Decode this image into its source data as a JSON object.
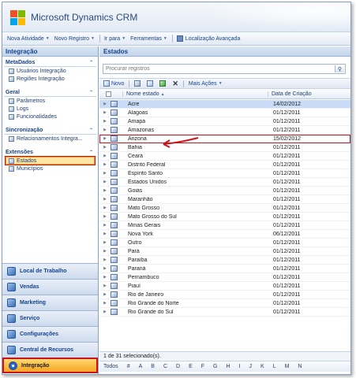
{
  "app": {
    "title": "Microsoft Dynamics CRM"
  },
  "menubar": {
    "items": [
      {
        "label": "Nova Atividade"
      },
      {
        "label": "Novo Registro"
      },
      {
        "label": "Ir para"
      },
      {
        "label": "Ferramentas"
      },
      {
        "label": "Localização Avançada"
      }
    ]
  },
  "leftnav": {
    "title": "Integração",
    "groups": [
      {
        "label": "MetaDados",
        "items": [
          "Usuários Integração",
          "Regiões Integração"
        ]
      },
      {
        "label": "Geral",
        "items": [
          "Parâmetros",
          "Logs",
          "Funcionalidades"
        ]
      },
      {
        "label": "Sincronização",
        "items": [
          "Relacionamentos Integra..."
        ]
      },
      {
        "label": "Extensões",
        "items": [
          "Estados",
          "Municípios"
        ]
      }
    ],
    "selected_item": "Estados",
    "wunderbar": [
      "Local de Trabalho",
      "Vendas",
      "Marketing",
      "Serviço",
      "Configurações",
      "Central de Recursos",
      "Integração"
    ],
    "active_area": "Integração"
  },
  "main": {
    "title": "Estados",
    "search": {
      "placeholder": "Procurar registros",
      "value": ""
    },
    "toolbar": {
      "new_label": "Novo",
      "more_actions_label": "Mais Ações"
    },
    "columns": {
      "name": "Nome estado",
      "date": "Data de Criação"
    },
    "rows": [
      {
        "name": "Acre",
        "date": "14/02/2012"
      },
      {
        "name": "Alagoas",
        "date": "01/12/2011"
      },
      {
        "name": "Amapá",
        "date": "01/12/2011"
      },
      {
        "name": "Amazonas",
        "date": "01/12/2011"
      },
      {
        "name": "Arizona",
        "date": "15/02/2012"
      },
      {
        "name": "Bahia",
        "date": "01/12/2011"
      },
      {
        "name": "Ceará",
        "date": "01/12/2011"
      },
      {
        "name": "Distrito Federal",
        "date": "01/12/2011"
      },
      {
        "name": "Espírito Santo",
        "date": "01/12/2011"
      },
      {
        "name": "Estados Unidos",
        "date": "01/12/2011"
      },
      {
        "name": "Goiás",
        "date": "01/12/2011"
      },
      {
        "name": "Maranhão",
        "date": "01/12/2011"
      },
      {
        "name": "Mato Grosso",
        "date": "01/12/2011"
      },
      {
        "name": "Mato Grosso do Sul",
        "date": "01/12/2011"
      },
      {
        "name": "Minas Gerais",
        "date": "01/12/2011"
      },
      {
        "name": "Nova York",
        "date": "06/12/2011"
      },
      {
        "name": "Outro",
        "date": "01/12/2011"
      },
      {
        "name": "Pará",
        "date": "01/12/2011"
      },
      {
        "name": "Paraíba",
        "date": "01/12/2011"
      },
      {
        "name": "Paraná",
        "date": "01/12/2011"
      },
      {
        "name": "Pernambuco",
        "date": "01/12/2011"
      },
      {
        "name": "Piauí",
        "date": "01/12/2011"
      },
      {
        "name": "Rio de Janeiro",
        "date": "01/12/2011"
      },
      {
        "name": "Rio Grande do Norte",
        "date": "01/12/2011"
      },
      {
        "name": "Rio Grande do Sul",
        "date": "01/12/2011"
      }
    ],
    "selected_row": "Acre",
    "highlighted_row": "Arizona",
    "status": "1 de 31 selecionado(s).",
    "jumpbar": [
      "Todos",
      "#",
      "A",
      "B",
      "C",
      "D",
      "E",
      "F",
      "G",
      "H",
      "I",
      "J",
      "K",
      "L",
      "M",
      "N"
    ]
  },
  "colors": {
    "accent": "#15428b",
    "highlight": "#c8141e",
    "selected": "#ffd66e"
  }
}
